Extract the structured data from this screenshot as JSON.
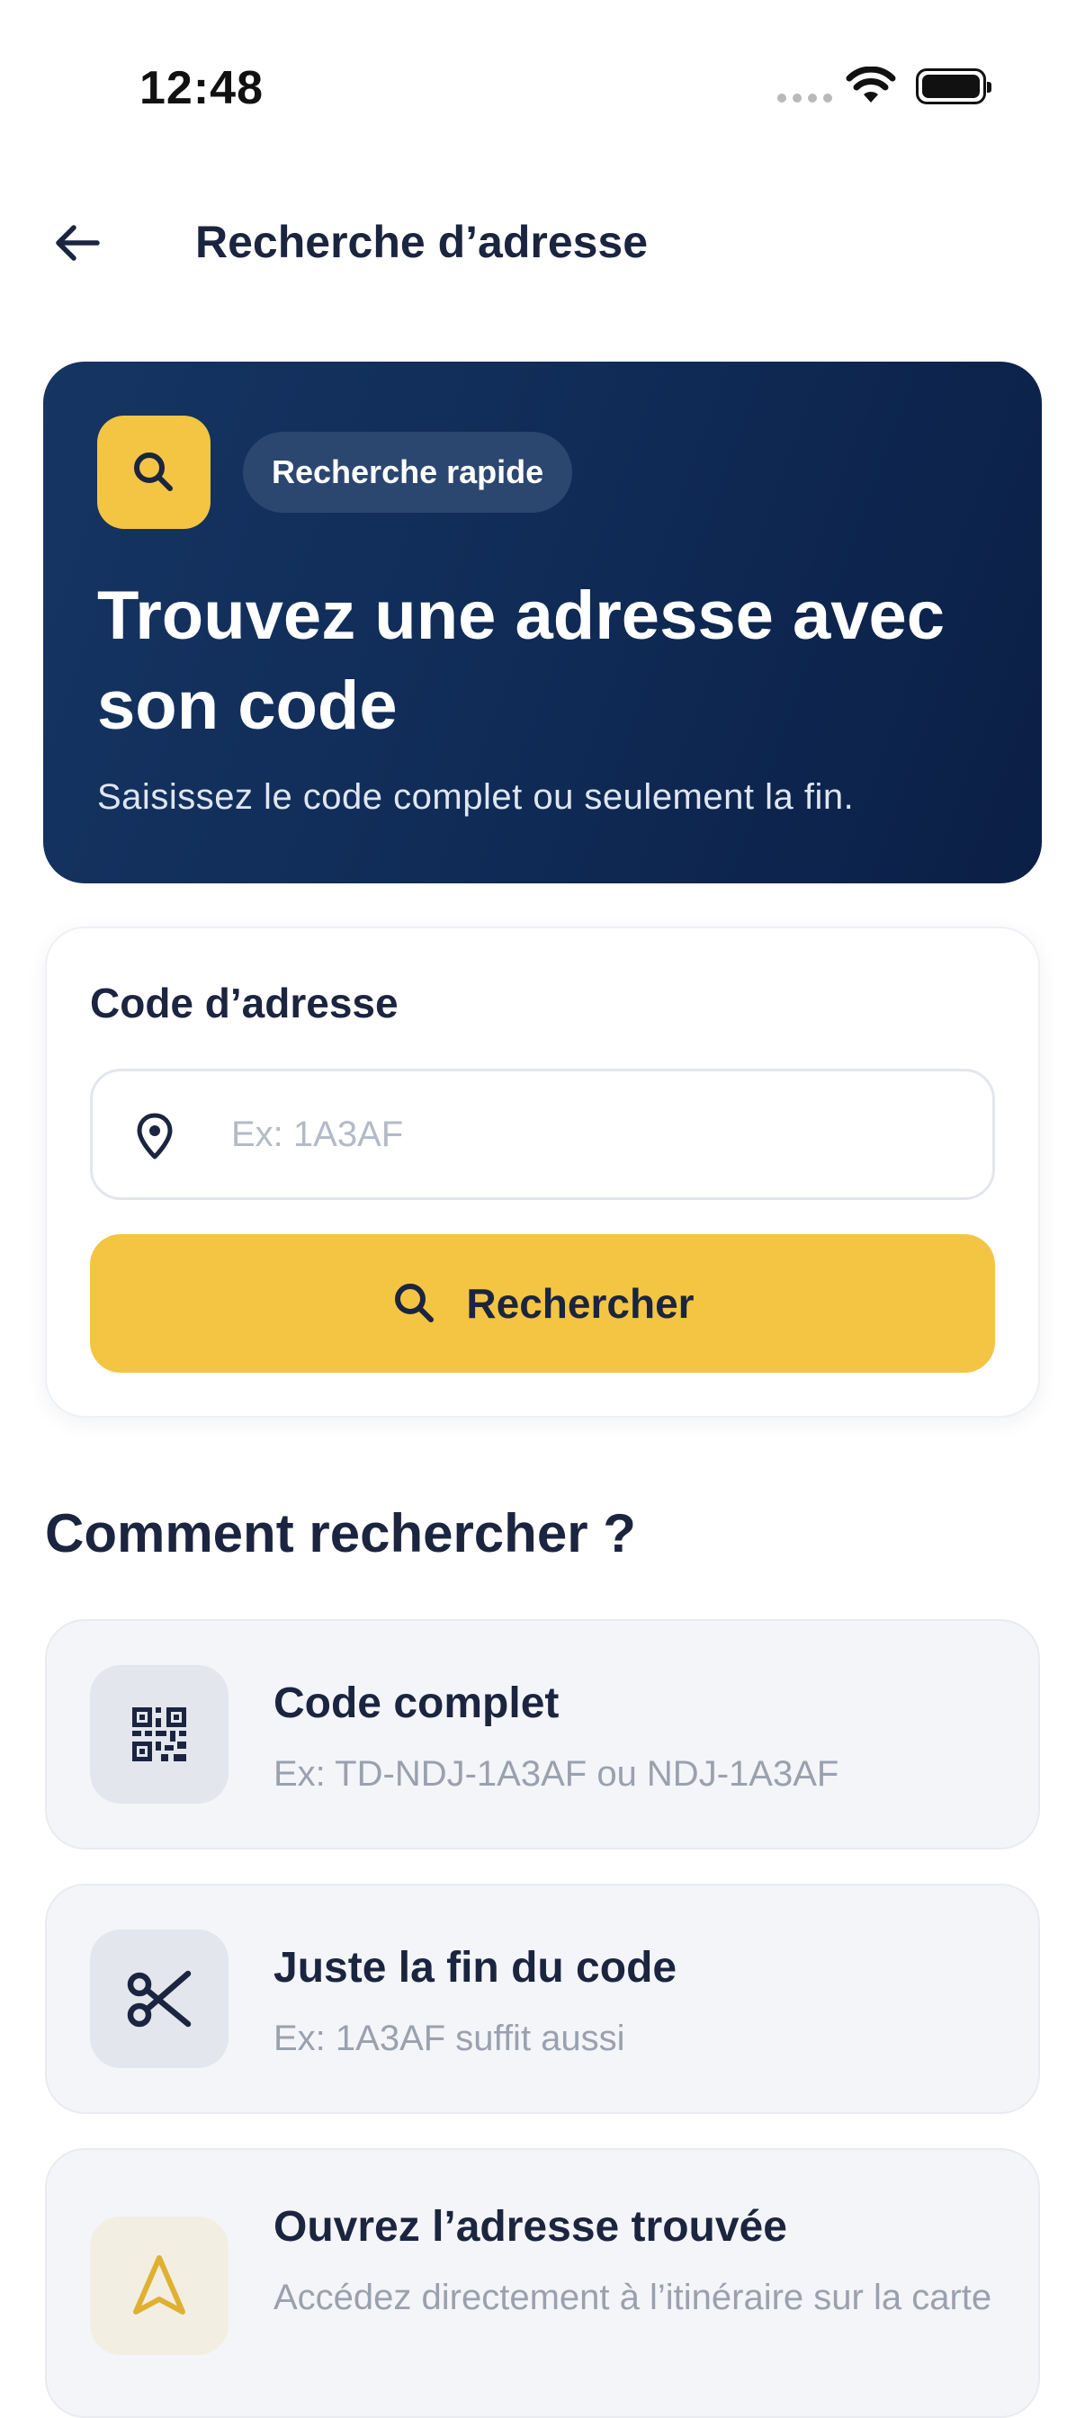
{
  "status_bar": {
    "time": "12:48"
  },
  "header": {
    "title": "Recherche d’adresse"
  },
  "hero": {
    "badge": "Recherche rapide",
    "title": "Trouvez une adresse avec son code",
    "subtitle": "Saisissez le code complet ou seulement la fin."
  },
  "form": {
    "label": "Code d’adresse",
    "input_value": "",
    "input_placeholder": "Ex: 1A3AF",
    "button_label": "Rechercher"
  },
  "howto": {
    "title": "Comment rechercher ?",
    "items": [
      {
        "icon": "qr-code-icon",
        "title": "Code complet",
        "desc": "Ex: TD-NDJ-1A3AF ou NDJ-1A3AF"
      },
      {
        "icon": "scissors-icon",
        "title": "Juste la fin du code",
        "desc": "Ex: 1A3AF suffit aussi"
      },
      {
        "icon": "navigation-arrow-icon",
        "title": "Ouvrez l’adresse trouvée",
        "desc": "Accédez directement à l’itinéraire sur la carte"
      }
    ]
  },
  "colors": {
    "navy": "#0f2a55",
    "accent_yellow": "#f4c542",
    "text_dark": "#1b2540",
    "muted": "#9aa1ae"
  }
}
